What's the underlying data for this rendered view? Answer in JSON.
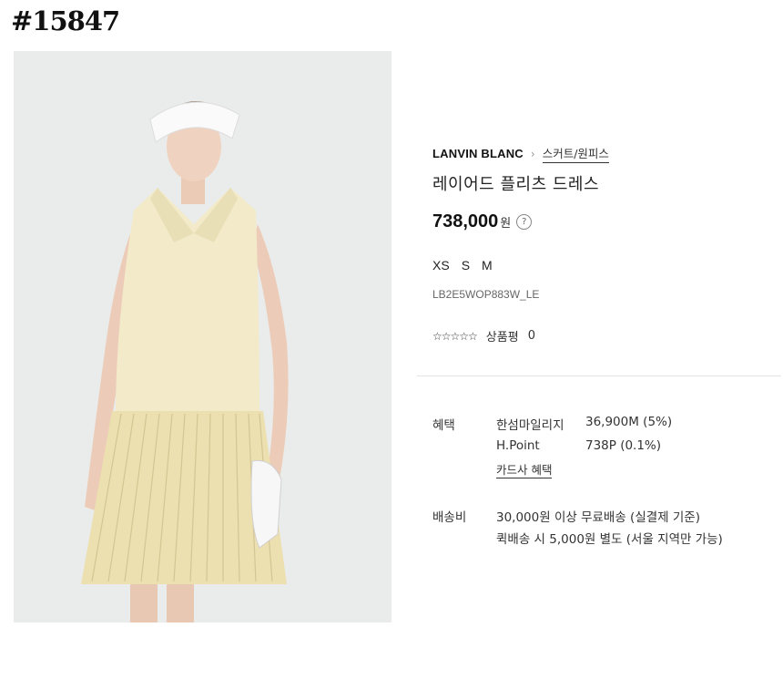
{
  "tag": "#15847",
  "product": {
    "brand": "LANVIN BLANC",
    "category": "스커트/원피스",
    "title": "레이어드 플리츠 드레스",
    "price": "738,000",
    "price_unit": "원",
    "help_symbol": "?",
    "sizes": [
      "XS",
      "S",
      "M"
    ],
    "code": "LB2E5WOP883W_LE",
    "stars": "☆☆☆☆☆",
    "rating": 0,
    "review_label": "상품평",
    "review_count": "0"
  },
  "benefits": {
    "label": "혜택",
    "items": [
      {
        "name": "한섬마일리지",
        "value": "36,900M (5%)"
      },
      {
        "name": "H.Point",
        "value": "738P (0.1%)"
      }
    ],
    "card_link": "카드사 혜택"
  },
  "shipping": {
    "label": "배송비",
    "line1": "30,000원 이상 무료배송 (실결제 기준)",
    "line2": "퀵배송 시 5,000원 별도 (서울 지역만 가능)"
  },
  "colors": {
    "dress": "#f1e9c6",
    "background": "#e9ebea"
  }
}
